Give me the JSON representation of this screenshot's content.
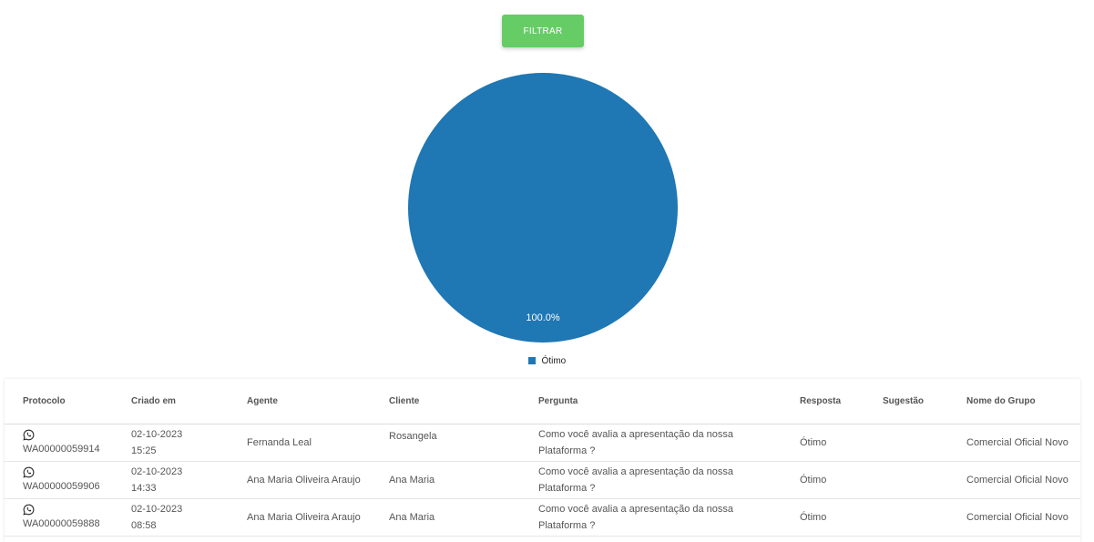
{
  "filter": {
    "label": "FILTRAR"
  },
  "chart_data": {
    "type": "pie",
    "categories": [
      "Ótimo"
    ],
    "values": [
      100
    ],
    "labels": [
      "100.0%"
    ],
    "colors": [
      "#1f77b4"
    ],
    "legend": "bottom"
  },
  "legend": {
    "items": [
      {
        "label": "Ótimo",
        "color": "#1f77b4"
      }
    ]
  },
  "table": {
    "headers": {
      "protocolo": "Protocolo",
      "criado": "Criado em",
      "agente": "Agente",
      "cliente": "Cliente",
      "pergunta": "Pergunta",
      "resposta": "Resposta",
      "sugestao": "Sugestão",
      "grupo": "Nome do Grupo"
    },
    "rows": [
      {
        "protocolo": "WA00000059914",
        "data": "02-10-2023",
        "hora": "15:25",
        "agente": "Fernanda Leal",
        "cliente": "Rosangela",
        "pergunta": "Como você avalia a apresentação da nossa Plataforma ?",
        "resposta": "Ótimo",
        "sugestao": "",
        "grupo": "Comercial Oficial Novo"
      },
      {
        "protocolo": "WA00000059906",
        "data": "02-10-2023",
        "hora": "14:33",
        "agente": "Ana Maria Oliveira Araujo",
        "cliente": "Ana Maria",
        "pergunta": "Como você avalia a apresentação da nossa Plataforma ?",
        "resposta": "Ótimo",
        "sugestao": "",
        "grupo": "Comercial Oficial Novo"
      },
      {
        "protocolo": "WA00000059888",
        "data": "02-10-2023",
        "hora": "08:58",
        "agente": "Ana Maria Oliveira Araujo",
        "cliente": "Ana Maria",
        "pergunta": "Como você avalia a apresentação da nossa Plataforma ?",
        "resposta": "Ótimo",
        "sugestao": "",
        "grupo": "Comercial Oficial Novo"
      }
    ]
  }
}
